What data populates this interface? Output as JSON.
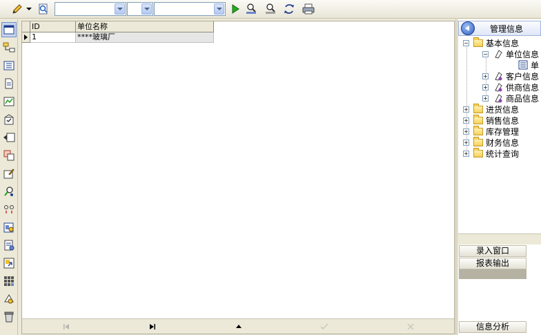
{
  "toolbar": {
    "combos": [
      {
        "value": ""
      },
      {
        "value": ""
      },
      {
        "value": ""
      }
    ],
    "icons": [
      "pencil-icon",
      "find-icon",
      "run-icon",
      "search-person-icon",
      "search-doc-icon",
      "refresh-icon",
      "print-icon"
    ]
  },
  "left_toolbar": {
    "icons": [
      "window-icon",
      "tree-icon",
      "form-icon",
      "document-icon",
      "chart-icon",
      "mail-icon",
      "arrow-box-icon",
      "copy-icon",
      "edit-icon",
      "search-users-icon",
      "link-icon",
      "report-icon",
      "page-icon",
      "export-icon",
      "grid-icon",
      "settings-icon",
      "trash-icon"
    ]
  },
  "grid": {
    "columns": [
      "ID",
      "单位名称"
    ],
    "rows": [
      {
        "id": "1",
        "name": "****玻璃厂"
      }
    ]
  },
  "navigator": {
    "buttons": [
      "first",
      "last",
      "up",
      "post",
      "cancel"
    ]
  },
  "right_panel": {
    "title": "管理信息",
    "tree": [
      {
        "label": "基本信息",
        "expander": "−"
      },
      {
        "label": "单位信息",
        "expander": "−"
      },
      {
        "label": "单"
      },
      {
        "label": "客户信息",
        "expander": "+"
      },
      {
        "label": "供商信息",
        "expander": "+"
      },
      {
        "label": "商品信息",
        "expander": "+"
      },
      {
        "label": "进货信息",
        "expander": "+"
      },
      {
        "label": "销售信息",
        "expander": "+"
      },
      {
        "label": "库存管理",
        "expander": "+"
      },
      {
        "label": "财务信息",
        "expander": "+"
      },
      {
        "label": "统计查询",
        "expander": "+"
      }
    ],
    "buttons": {
      "entry": "录入窗口",
      "report": "报表输出",
      "analysis": "信息分析"
    }
  }
}
